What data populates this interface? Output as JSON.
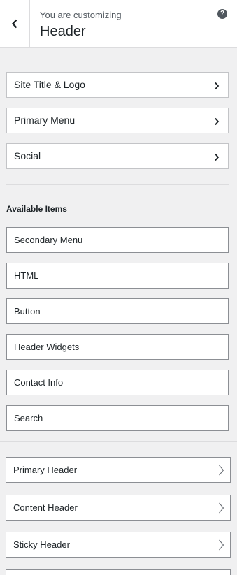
{
  "header": {
    "subtitle": "You are customizing",
    "title": "Header",
    "help_label": "?"
  },
  "sections": [
    {
      "label": "Site Title & Logo"
    },
    {
      "label": "Primary Menu"
    },
    {
      "label": "Social"
    }
  ],
  "available": {
    "heading": "Available Items",
    "items": [
      {
        "label": "Secondary Menu"
      },
      {
        "label": "HTML"
      },
      {
        "label": "Button"
      },
      {
        "label": "Header Widgets"
      },
      {
        "label": "Contact Info"
      },
      {
        "label": "Search"
      }
    ]
  },
  "sub_sections": [
    {
      "label": "Primary Header"
    },
    {
      "label": "Content Header"
    },
    {
      "label": "Sticky Header"
    }
  ],
  "icons": {
    "back": "chevron-left-icon",
    "help": "question-circle-icon",
    "section_arrow": "chevron-right-icon"
  }
}
